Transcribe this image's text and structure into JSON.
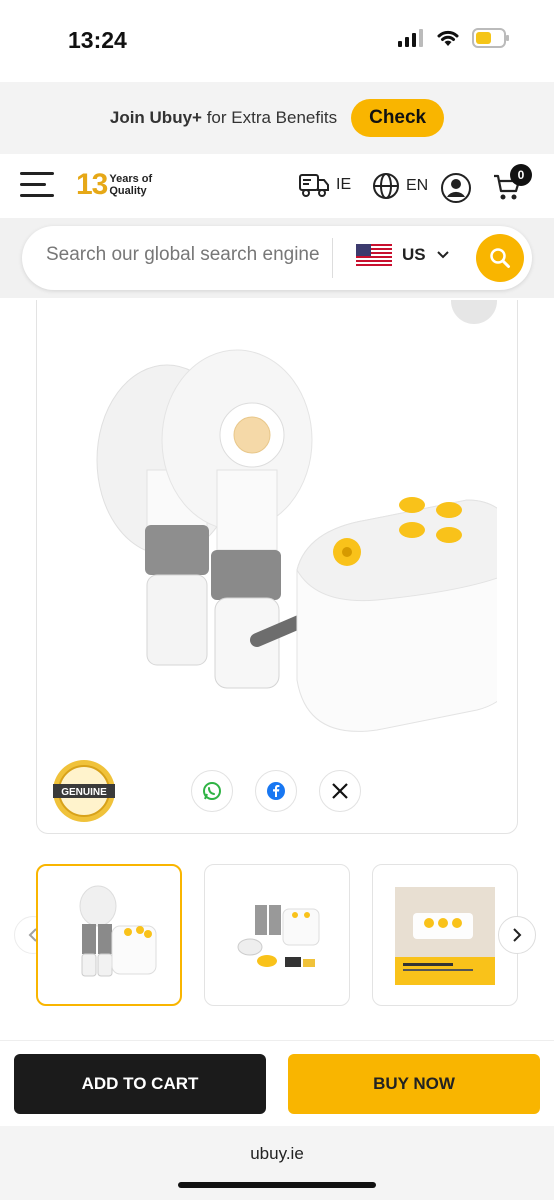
{
  "status_bar": {
    "time": "13:24"
  },
  "promo": {
    "brand": "Join Ubuy+",
    "text": "for Extra Benefits",
    "button": "Check"
  },
  "header": {
    "logo_number": "13",
    "logo_line1": "Years of",
    "logo_line2": "Quality",
    "delivery_country": "IE",
    "language": "EN",
    "cart_count": "0"
  },
  "search": {
    "placeholder": "Search our global search engine",
    "country": "US"
  },
  "product": {
    "badge_line1": "GENUINE",
    "share": [
      "whatsapp",
      "facebook",
      "x"
    ]
  },
  "actions": {
    "add_to_cart": "ADD TO CART",
    "buy_now": "BUY NOW"
  },
  "browser": {
    "url": "ubuy.ie"
  },
  "colors": {
    "accent": "#f9b500",
    "dark": "#1b1b1b"
  }
}
